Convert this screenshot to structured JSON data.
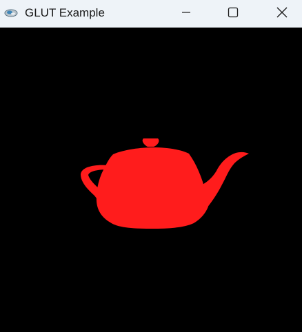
{
  "window": {
    "title": "GLUT Example",
    "app_icon": "glut-app-icon",
    "controls": {
      "minimize_icon": "minimize-icon",
      "maximize_icon": "maximize-icon",
      "close_icon": "close-icon"
    }
  },
  "scene": {
    "background_color": "#000000",
    "object": "teapot",
    "object_color": "#ff1c1c"
  }
}
